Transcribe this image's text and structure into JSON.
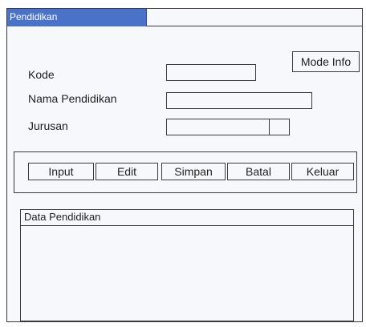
{
  "window": {
    "title": "Pendidikan"
  },
  "mode_button": {
    "label": "Mode Info"
  },
  "form": {
    "kode": {
      "label": "Kode",
      "value": ""
    },
    "nama_pendidikan": {
      "label": "Nama Pendidikan",
      "value": ""
    },
    "jurusan": {
      "label": "Jurusan",
      "value": ""
    }
  },
  "buttons": {
    "input": "Input",
    "edit": "Edit",
    "simpan": "Simpan",
    "batal": "Batal",
    "keluar": "Keluar"
  },
  "grid": {
    "title": "Data Pendidikan",
    "rows": []
  },
  "colors": {
    "title_bar": "#4a72c8",
    "background": "#f7f8fb",
    "border": "#3a3a3a"
  }
}
